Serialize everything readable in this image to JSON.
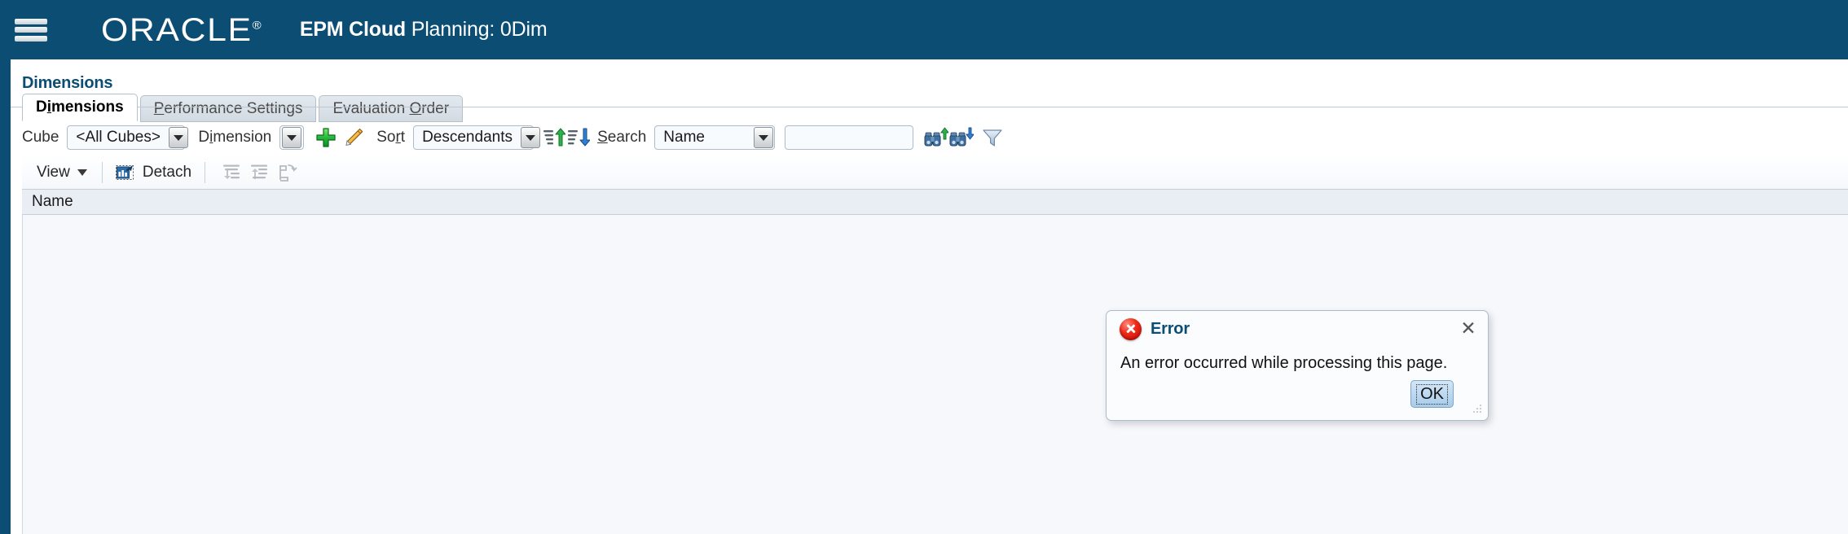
{
  "header": {
    "menu_icon": "hamburger-menu-icon",
    "brand": "ORACLE",
    "brand_reg": "®",
    "app_name_bold": "EPM Cloud",
    "app_name_rest": " Planning: 0Dim"
  },
  "page": {
    "title": "Dimensions"
  },
  "tabs": [
    {
      "label": "Dimensions",
      "mnemonic": "i",
      "active": true
    },
    {
      "label": "Performance Settings",
      "mnemonic": "P",
      "active": false
    },
    {
      "label": "Evaluation Order",
      "mnemonic": "O",
      "active": false
    }
  ],
  "filter_bar": {
    "cube_label": "Cube",
    "cube_value": "<All Cubes>",
    "dimension_label": "Dimension",
    "dimension_mnemonic": "i",
    "dimension_value": "",
    "add_icon": "add-plus-icon",
    "edit_icon": "edit-pencil-icon",
    "sort_label": "Sort",
    "sort_mnemonic": "r",
    "sort_value": "Descendants",
    "sort_asc_icon": "sort-ascending-icon",
    "sort_desc_icon": "sort-descending-icon",
    "search_label": "Search",
    "search_mnemonic": "S",
    "search_field_value": "Name",
    "search_text_value": "",
    "search_text_placeholder": "",
    "find_up_icon": "find-previous-binoculars-icon",
    "find_down_icon": "find-next-binoculars-icon",
    "filter_icon": "filter-funnel-icon"
  },
  "view_bar": {
    "view_label": "View",
    "view_caret_icon": "chevron-down-icon",
    "detach_label": "Detach",
    "detach_icon": "detach-chart-icon",
    "indent_down_icon": "move-down-indent-icon",
    "indent_up_icon": "move-up-indent-icon",
    "reorder_icon": "change-parent-icon"
  },
  "table": {
    "columns": [
      "Name"
    ],
    "rows": []
  },
  "dialog": {
    "icon": "error-circle-icon",
    "title": "Error",
    "close_icon": "close-icon",
    "message": "An error occurred while processing this page.",
    "ok_label": "OK",
    "resize_grip_icon": "resize-grip-icon"
  },
  "colors": {
    "brand_blue": "#0b4d73",
    "panel_bg": "#ffffff",
    "table_bg": "#f6f8fc",
    "header_row_bg": "#e9eef5",
    "error_red": "#ef2a18"
  }
}
